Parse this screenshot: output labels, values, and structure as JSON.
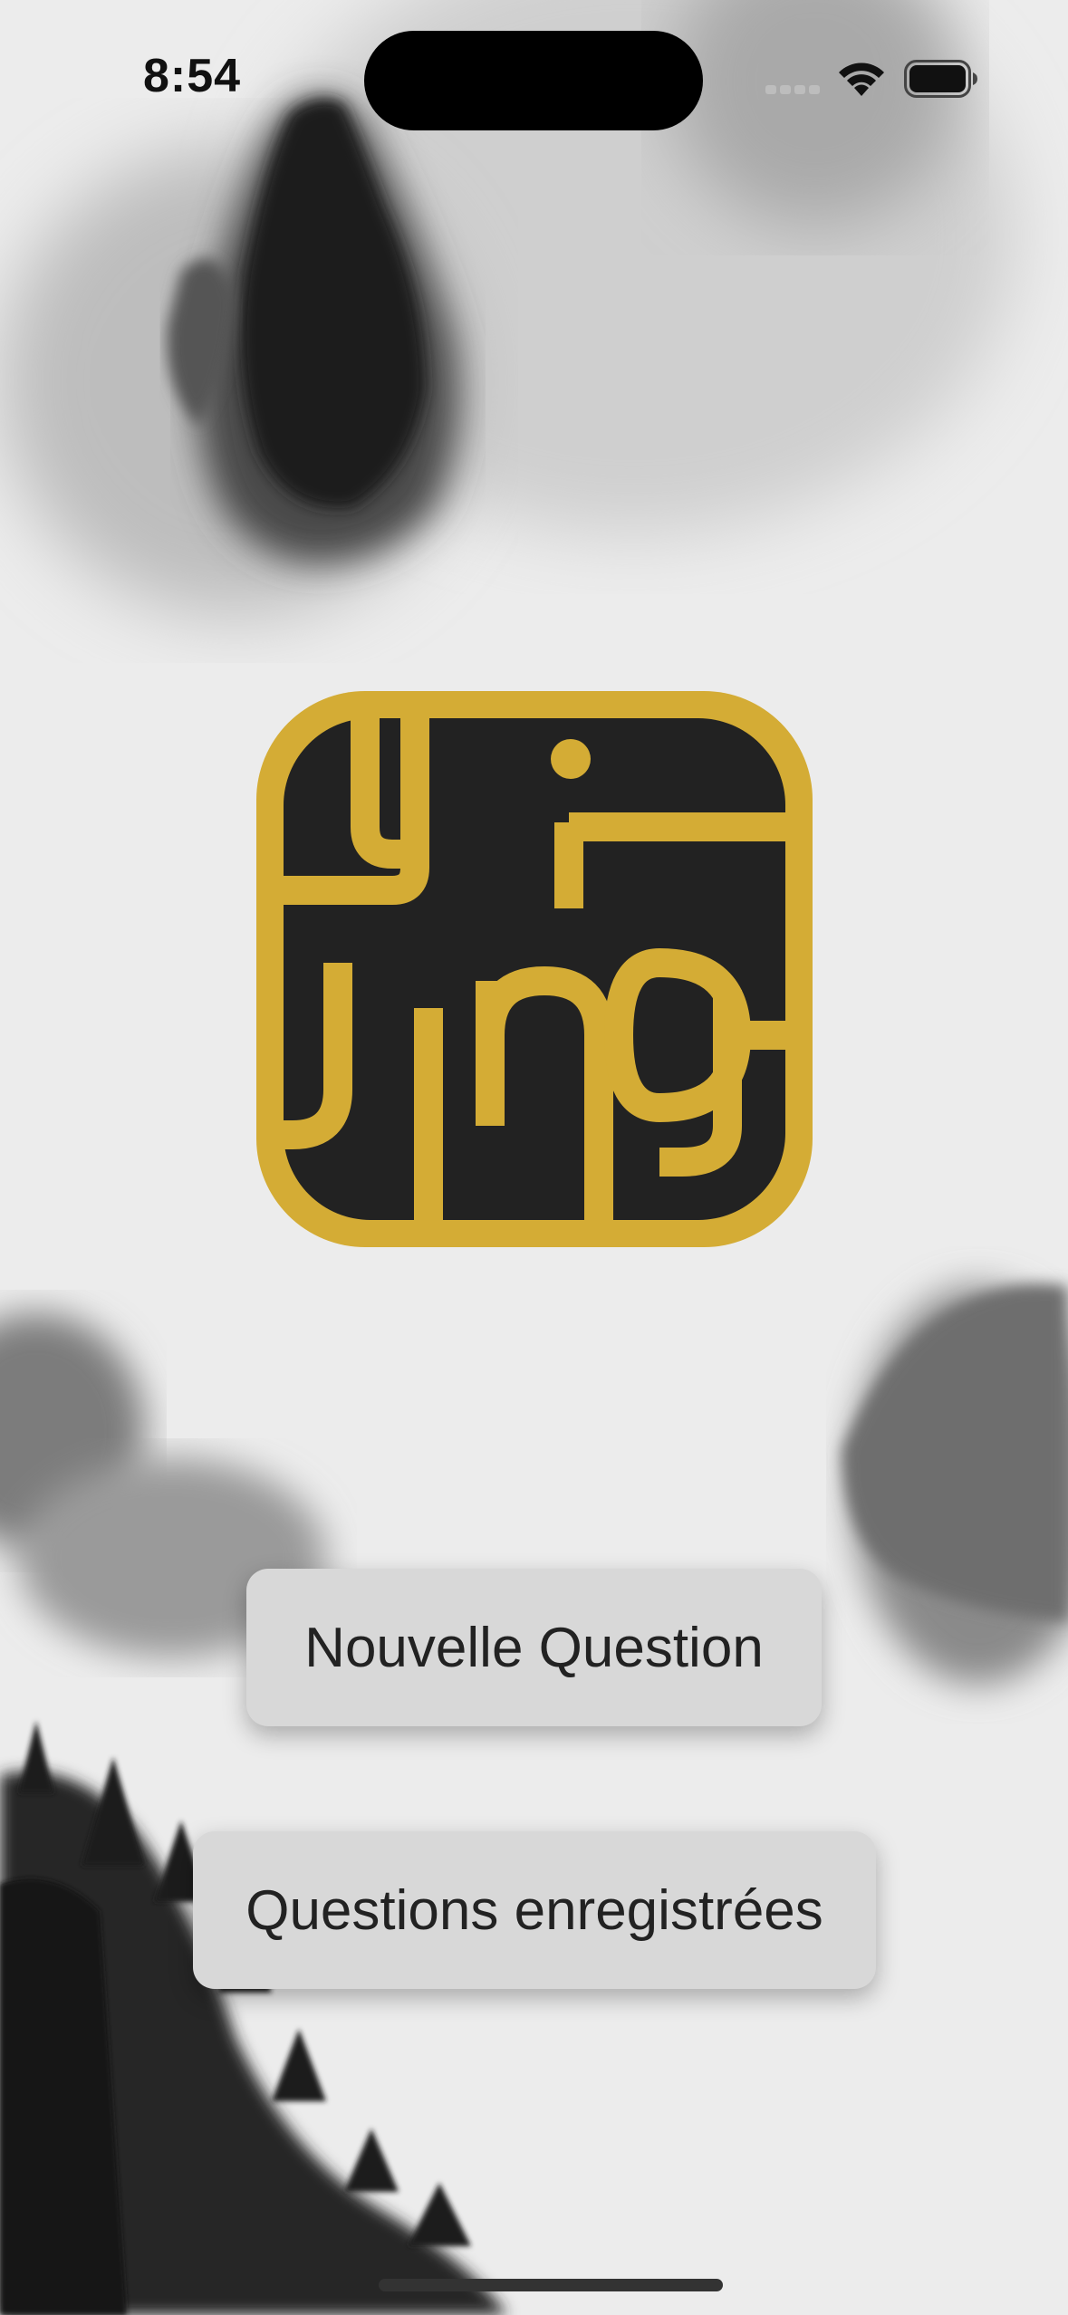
{
  "status_bar": {
    "time": "8:54",
    "icons": [
      "cellular-signal-icon",
      "wifi-icon",
      "battery-icon"
    ]
  },
  "logo": {
    "text_top": "Yi",
    "text_bottom": "Jing",
    "colors": {
      "gold": "#D4AC35",
      "dark": "#222222"
    }
  },
  "buttons": {
    "new_question": "Nouvelle Question",
    "saved_questions": "Questions enregistrées"
  },
  "colors": {
    "button_bg": "#D8D8D8",
    "button_text": "#222222"
  }
}
